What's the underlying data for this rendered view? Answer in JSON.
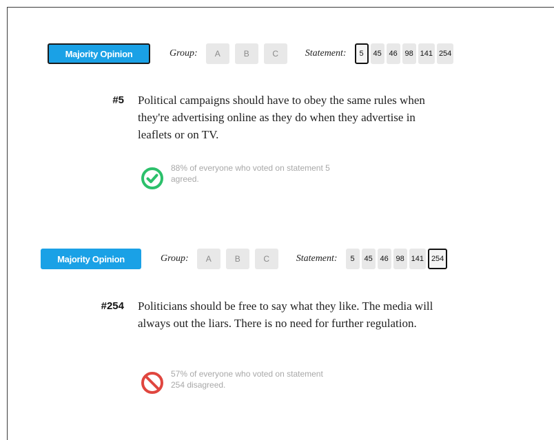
{
  "colors": {
    "accent": "#1aa1e6",
    "agree": "#2cc06b",
    "disagree": "#e0463f",
    "chip_bg": "#e8e8e8"
  },
  "blocks": [
    {
      "majority_label": "Majority Opinion",
      "group_label": "Group:",
      "groups": [
        "A",
        "B",
        "C"
      ],
      "statement_label": "Statement:",
      "statements": [
        "5",
        "45",
        "46",
        "98",
        "141",
        "254"
      ],
      "selected_statement": "5",
      "number": "#5",
      "text": "Political campaigns should have to obey the same rules when they're advertising online as they do when they advertise in leaflets or on TV.",
      "result_icon": "check-circle-icon",
      "result_text": "88% of everyone who voted on statement 5 agreed."
    },
    {
      "majority_label": "Majority Opinion",
      "group_label": "Group:",
      "groups": [
        "A",
        "B",
        "C"
      ],
      "statement_label": "Statement:",
      "statements": [
        "5",
        "45",
        "46",
        "98",
        "141",
        "254"
      ],
      "selected_statement": "254",
      "number": "#254",
      "text": "Politicians should be free to say what they like. The media will always out the liars. There is no need for further regulation.",
      "result_icon": "prohibited-icon",
      "result_text": "57% of everyone who voted on statement 254 disagreed."
    }
  ]
}
